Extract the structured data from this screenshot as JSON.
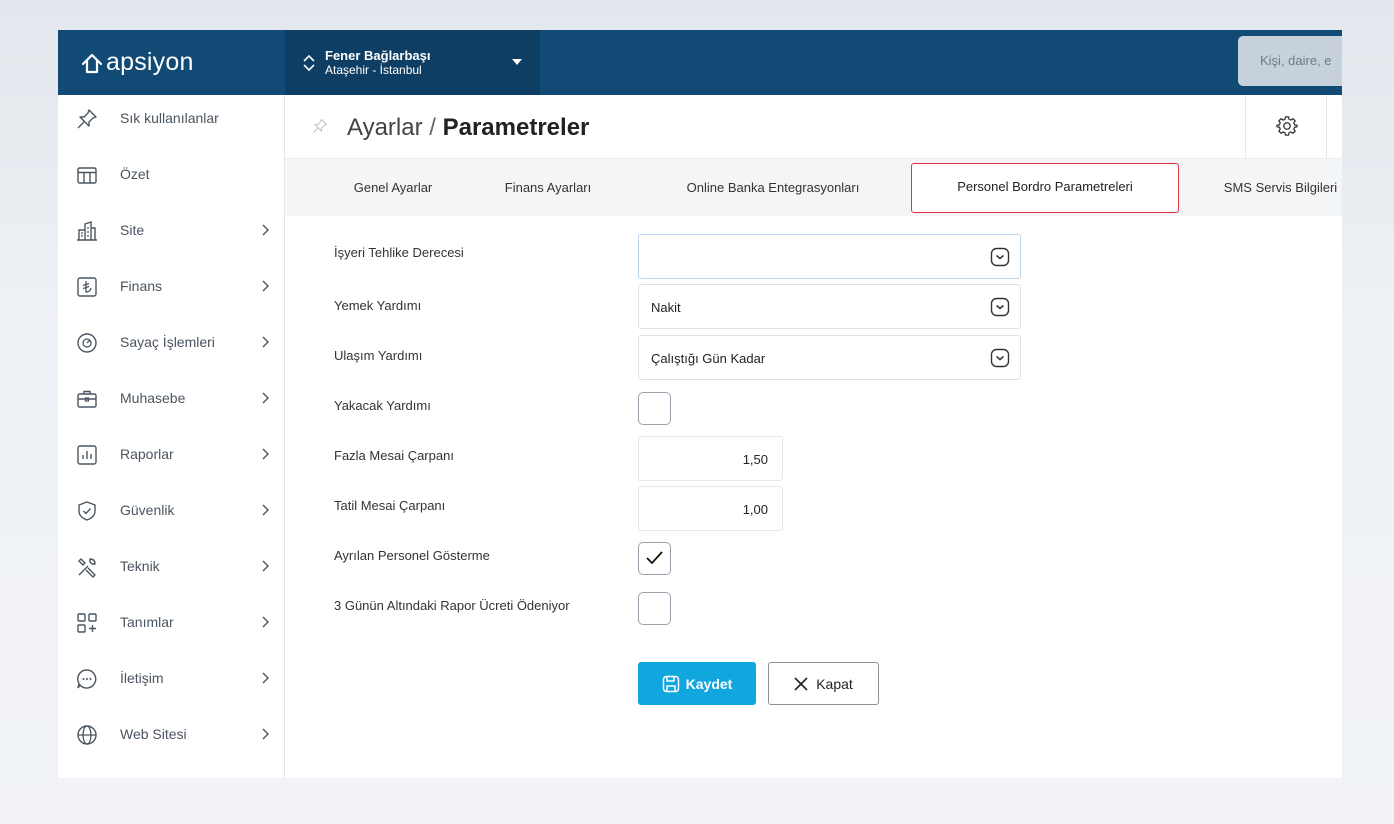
{
  "app": {
    "brand": "apsiyon"
  },
  "site": {
    "name": "Fener Bağlarbaşı",
    "location": "Ataşehir - İstanbul"
  },
  "search": {
    "placeholder": "Kişi, daire, e"
  },
  "sidebar": {
    "items": [
      {
        "label": "Sık kullanılanlar",
        "icon": "pin-icon",
        "has_children": false
      },
      {
        "label": "Özet",
        "icon": "table-icon",
        "has_children": false
      },
      {
        "label": "Site",
        "icon": "building-icon",
        "has_children": true
      },
      {
        "label": "Finans",
        "icon": "lira-icon",
        "has_children": true
      },
      {
        "label": "Sayaç İşlemleri",
        "icon": "gauge-icon",
        "has_children": true
      },
      {
        "label": "Muhasebe",
        "icon": "briefcase-icon",
        "has_children": true
      },
      {
        "label": "Raporlar",
        "icon": "report-icon",
        "has_children": true
      },
      {
        "label": "Güvenlik",
        "icon": "shield-icon",
        "has_children": true
      },
      {
        "label": "Teknik",
        "icon": "tools-icon",
        "has_children": true
      },
      {
        "label": "Tanımlar",
        "icon": "grid-plus-icon",
        "has_children": true
      },
      {
        "label": "İletişim",
        "icon": "chat-icon",
        "has_children": true
      },
      {
        "label": "Web Sitesi",
        "icon": "globe-icon",
        "has_children": true
      }
    ]
  },
  "breadcrumb": {
    "parent": "Ayarlar",
    "separator": "/",
    "current": "Parametreler"
  },
  "tabs": [
    {
      "label": "Genel Ayarlar",
      "active": false
    },
    {
      "label": "Finans Ayarları",
      "active": false
    },
    {
      "label": "Online Banka Entegrasyonları",
      "active": false
    },
    {
      "label": "Personel Bordro Parametreleri",
      "active": true
    },
    {
      "label": "SMS Servis Bilgileri",
      "active": false
    }
  ],
  "form": {
    "isyeri_tehlike": {
      "label": "İşyeri Tehlike Derecesi",
      "value": ""
    },
    "yemek": {
      "label": "Yemek Yardımı",
      "value": "Nakit"
    },
    "ulasim": {
      "label": "Ulaşım Yardımı",
      "value": "Çalıştığı Gün Kadar"
    },
    "yakacak": {
      "label": "Yakacak Yardımı",
      "checked": false
    },
    "fazla_mesai": {
      "label": "Fazla Mesai Çarpanı",
      "value": "1,50"
    },
    "tatil_mesai": {
      "label": "Tatil Mesai Çarpanı",
      "value": "1,00"
    },
    "ayrilan": {
      "label": "Ayrılan Personel Gösterme",
      "checked": true
    },
    "rapor": {
      "label": "3 Günün Altındaki Rapor Ücreti Ödeniyor",
      "checked": false
    }
  },
  "buttons": {
    "save": "Kaydet",
    "close": "Kapat"
  },
  "colors": {
    "topbar": "#114a75",
    "primary": "#11a6de",
    "active_tab_border": "#e2323c"
  }
}
